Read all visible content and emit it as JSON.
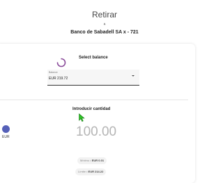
{
  "header": {
    "title": "Retirar",
    "sub": "a",
    "bank": "Banco de Sabadell SA x - 721"
  },
  "balance": {
    "heading": "Select balance",
    "field_label": "Balance",
    "value": "EUR 219.72"
  },
  "amount_section": {
    "heading": "Introducir cantidad",
    "amount": "100.00",
    "currency": "EUR"
  },
  "limits": {
    "min_label": "Mínimo •",
    "min_value": "EUR 0.01",
    "limit_label": "Límite •",
    "limit_value": "EUR 214.22"
  },
  "colors": {
    "currency_dot": "#5560b8",
    "spinner": "#8a4b9a",
    "cursor": "#2ec227"
  }
}
